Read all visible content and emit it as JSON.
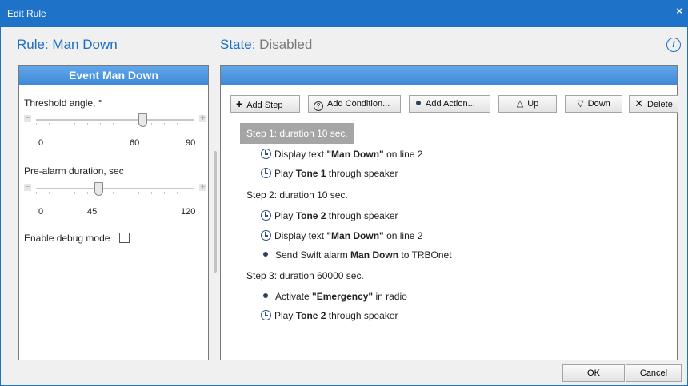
{
  "window": {
    "title": "Edit Rule",
    "close_glyph": "×"
  },
  "header": {
    "rule_prefix": "Rule:",
    "rule_name": "Man Down",
    "state_prefix": "State:",
    "state_value": "Disabled",
    "info_glyph": "i"
  },
  "left_panel": {
    "title": "Event  Man Down",
    "threshold": {
      "label": "Threshold angle, °",
      "min": "0",
      "mid": "60",
      "max": "90",
      "value": 60
    },
    "prealarm": {
      "label": "Pre-alarm duration, sec",
      "min": "0",
      "mid": "45",
      "max": "120",
      "value": 45
    },
    "debug": {
      "label": "Enable debug mode",
      "checked": false
    }
  },
  "toolbar": {
    "add_step": "Add Step",
    "add_condition": "Add Condition...",
    "add_action": "Add Action...",
    "up": "Up",
    "down": "Down",
    "delete": "Delete"
  },
  "steps": [
    {
      "label": "Step 1:",
      "duration": "duration 10 sec.",
      "items": [
        {
          "icon": "clock-icon",
          "pre": "Display text ",
          "bold": "\"Man Down\"",
          "post": " on line 2"
        },
        {
          "icon": "clock-icon",
          "pre": "Play ",
          "bold": "Tone 1",
          "post": " through speaker"
        }
      ]
    },
    {
      "label": "Step 2:",
      "duration": "duration 10 sec.",
      "items": [
        {
          "icon": "clock-icon",
          "pre": "Play ",
          "bold": "Tone 2",
          "post": " through speaker"
        },
        {
          "icon": "clock-icon",
          "pre": "Display text ",
          "bold": "\"Man Down\"",
          "post": " on line 2"
        },
        {
          "icon": "bullet-icon",
          "pre": "Send Swift alarm ",
          "bold": "Man Down",
          "post": " to TRBOnet"
        }
      ]
    },
    {
      "label": "Step 3:",
      "duration": "duration 60000 sec.",
      "items": [
        {
          "icon": "bullet-icon",
          "pre": "Activate ",
          "bold": "\"Emergency\"",
          "post": " in radio"
        },
        {
          "icon": "clock-icon",
          "pre": "Play ",
          "bold": "Tone 2",
          "post": " through speaker"
        }
      ]
    }
  ],
  "footer": {
    "ok": "OK",
    "cancel": "Cancel"
  },
  "colors": {
    "accent": "#1e73c9",
    "title_text": "#1c6fc2",
    "selection": "#a5a5a5"
  }
}
